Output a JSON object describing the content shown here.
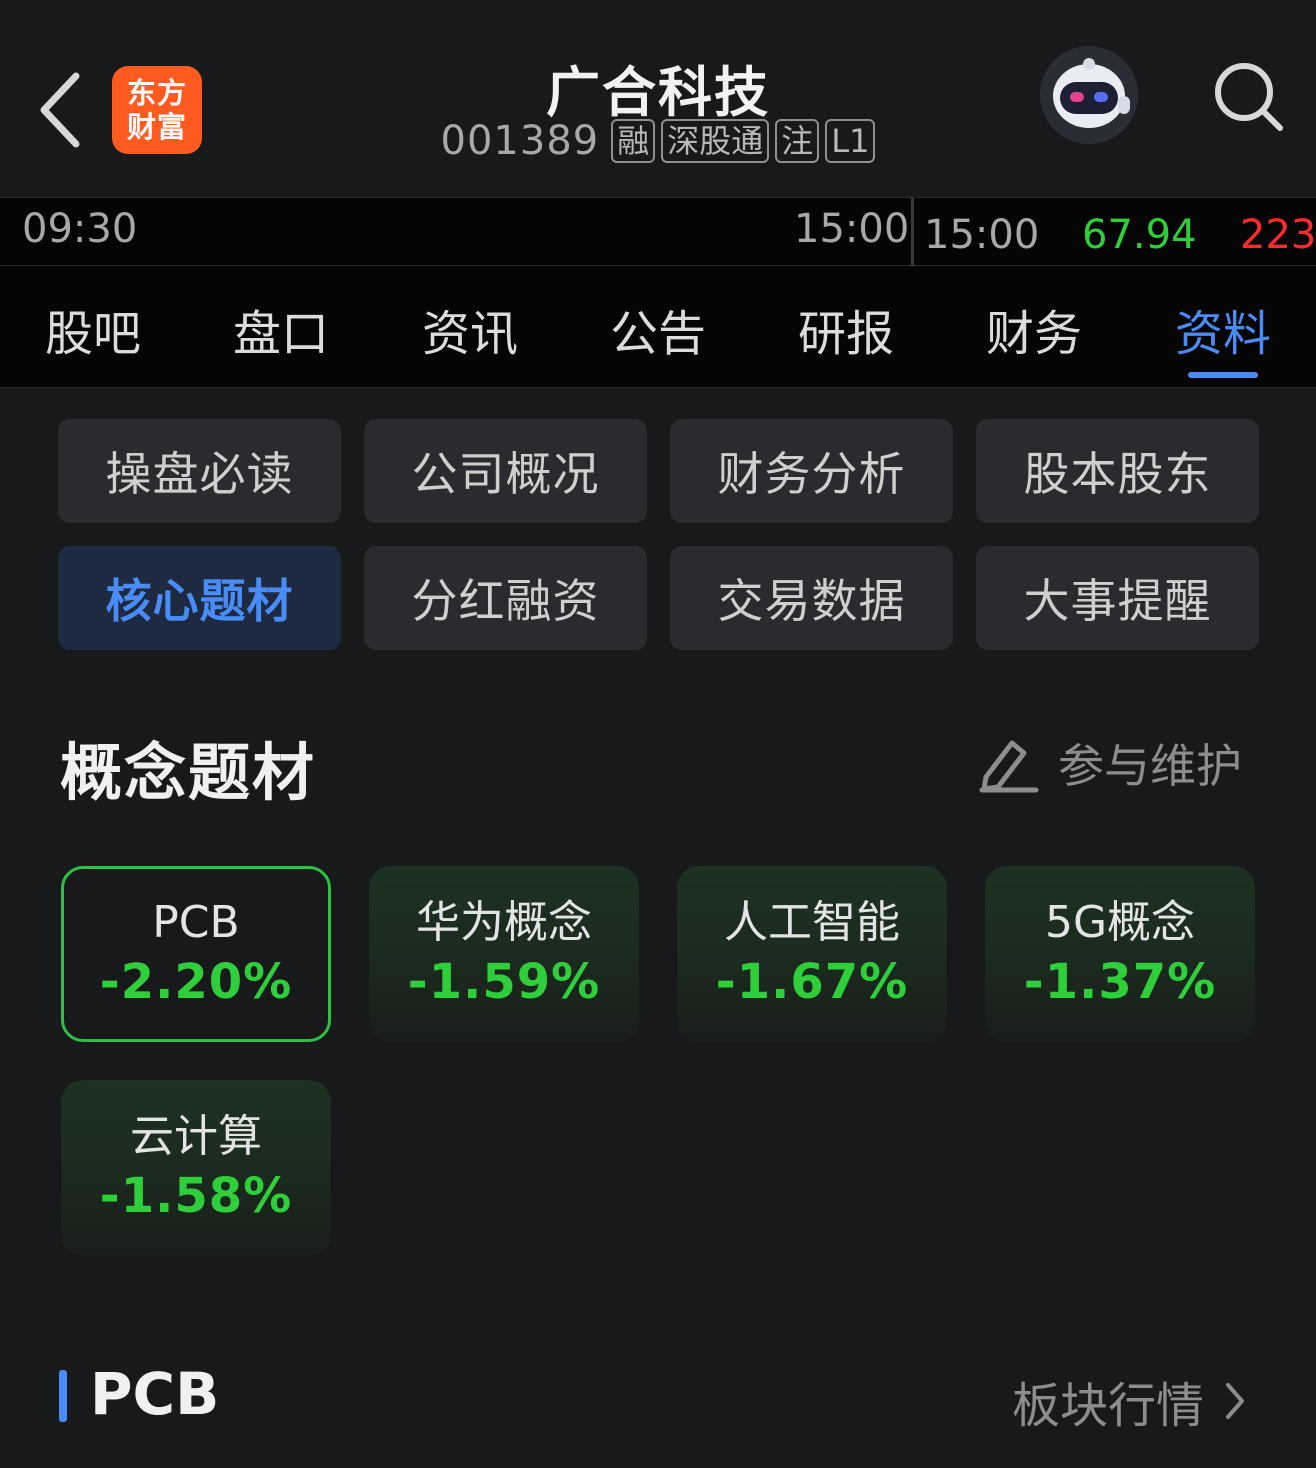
{
  "header": {
    "logo_line1": "东方",
    "logo_line2": "财富",
    "title": "广合科技",
    "code": "001389",
    "tags": [
      "融",
      "深股通",
      "注",
      "L1"
    ]
  },
  "timebar": {
    "start": "09:30",
    "end": "15:00",
    "latest_time": "15:00",
    "price": "67.94",
    "volume": "223"
  },
  "tabs": [
    "股吧",
    "盘口",
    "资讯",
    "公告",
    "研报",
    "财务",
    "资料"
  ],
  "active_tab": "资料",
  "sections": [
    "操盘必读",
    "公司概况",
    "财务分析",
    "股本股东",
    "核心题材",
    "分红融资",
    "交易数据",
    "大事提醒"
  ],
  "active_section": "核心题材",
  "concepts": {
    "title": "概念题材",
    "maintain_label": "参与维护",
    "items": [
      {
        "name": "PCB",
        "pct": "-2.20%"
      },
      {
        "name": "华为概念",
        "pct": "-1.59%"
      },
      {
        "name": "人工智能",
        "pct": "-1.67%"
      },
      {
        "name": "5G概念",
        "pct": "-1.37%"
      },
      {
        "name": "云计算",
        "pct": "-1.58%"
      }
    ]
  },
  "bottom": {
    "title": "PCB",
    "link_label": "板块行情"
  },
  "colors": {
    "accent_blue": "#4a8cf6",
    "down_green": "#2fcf3c",
    "up_red": "#ff2a2a",
    "logo_orange": "#ff5a1f"
  },
  "icons": [
    "back-arrow-icon",
    "robot-avatar-icon",
    "search-icon",
    "edit-pen-icon",
    "chevron-right-icon"
  ]
}
